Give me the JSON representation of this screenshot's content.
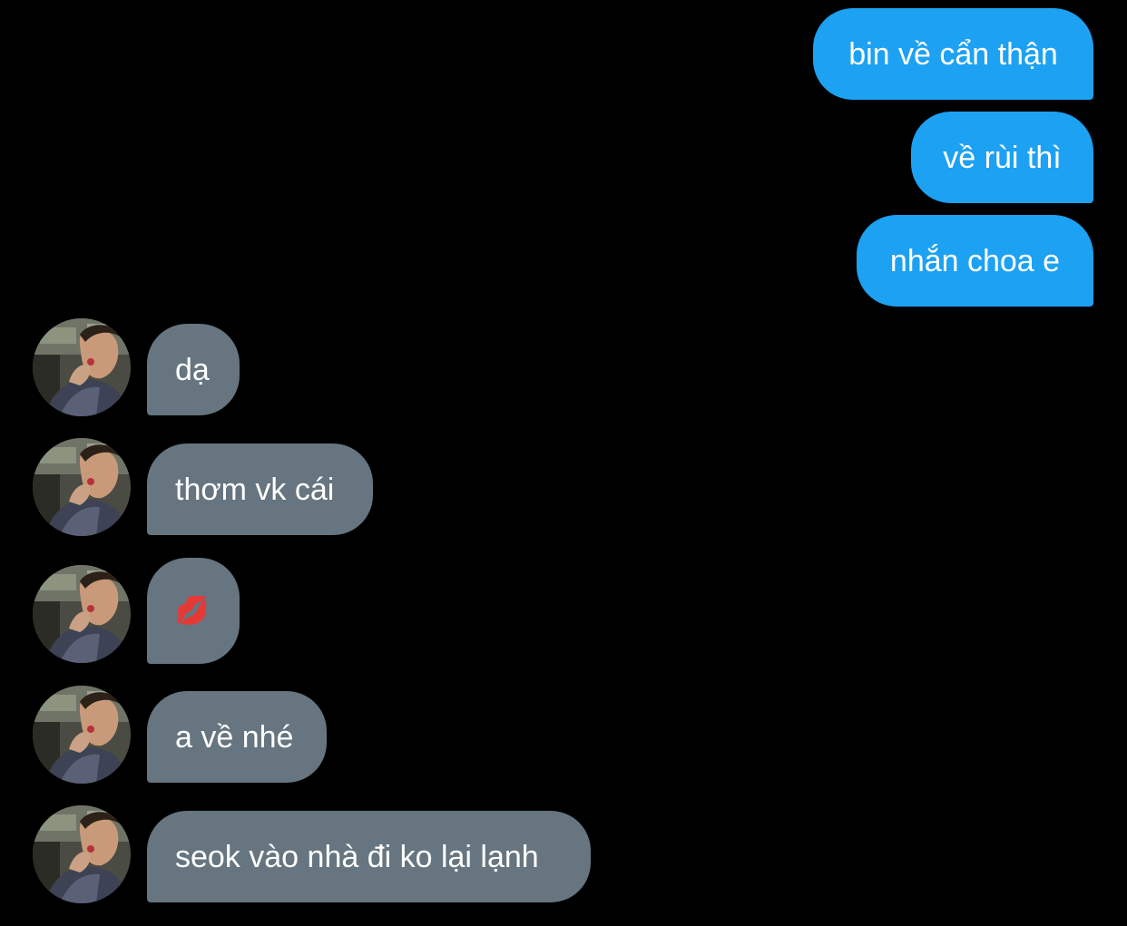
{
  "conversation": {
    "outgoing": [
      {
        "text": "bin về cẩn thận"
      },
      {
        "text": "về rùi thì"
      },
      {
        "text": "nhắn choa e"
      }
    ],
    "incoming": [
      {
        "text": "dạ"
      },
      {
        "text": "thơm vk cái"
      },
      {
        "text": "💋"
      },
      {
        "text": "a về nhé"
      },
      {
        "text": "seok vào nhà đi ko lại lạnh"
      }
    ]
  },
  "colors": {
    "background": "#000000",
    "outgoing_bubble": "#1da1f2",
    "incoming_bubble": "#66757f",
    "text": "#ffffff"
  },
  "icons": {
    "avatar": "user-avatar-photo",
    "kiss": "kiss-mark-emoji"
  }
}
